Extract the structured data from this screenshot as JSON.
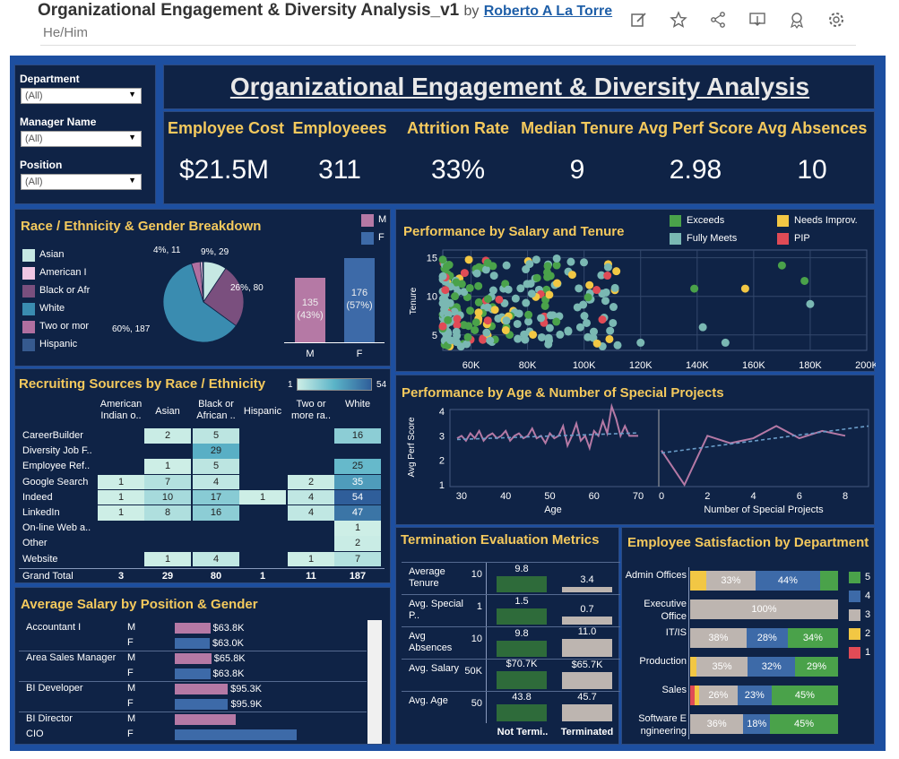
{
  "header": {
    "title": "Organizational Engagement & Diversity Analysis_v1",
    "by": "by",
    "author": "Roberto A La Torre",
    "pronouns": "He/Him"
  },
  "toolbar_icons": [
    "edit-icon",
    "star-icon",
    "share-icon",
    "download-icon",
    "badge-icon",
    "gear-icon"
  ],
  "filters": [
    {
      "label": "Department",
      "value": "(All)"
    },
    {
      "label": "Manager Name",
      "value": "(All)"
    },
    {
      "label": "Position",
      "value": "(All)"
    }
  ],
  "dashboard_title": "Organizational Engagement & Diversity Analysis",
  "kpis": [
    {
      "label": "Employee Cost",
      "value": "$21.5M"
    },
    {
      "label": "Employeees",
      "value": "311"
    },
    {
      "label": "Attrition Rate",
      "value": "33%"
    },
    {
      "label": "Median Tenure",
      "value": "9"
    },
    {
      "label": "Avg Perf Score",
      "value": "2.98"
    },
    {
      "label": "Avg Absences",
      "value": "10"
    }
  ],
  "race_section": {
    "title": "Race / Ethnicity & Gender Breakdown",
    "legend": [
      {
        "label": "Asian",
        "color": "#c6e8e3"
      },
      {
        "label": "American I",
        "color": "#f0c6e4"
      },
      {
        "label": "Black or Afr",
        "color": "#7a4f7e"
      },
      {
        "label": "White",
        "color": "#3a8cb0"
      },
      {
        "label": "Two or mor",
        "color": "#b06fa0"
      },
      {
        "label": "Hispanic",
        "color": "#365a8f"
      }
    ],
    "pie_labels": [
      "4%, 11",
      "9%, 29",
      "26%, 80",
      "60%, 187"
    ],
    "gender_legend": [
      {
        "label": "M",
        "color": "#b579a5"
      },
      {
        "label": "F",
        "color": "#3d6aa8"
      }
    ],
    "gender_bars": [
      {
        "label": "M",
        "text1": "135",
        "text2": "(43%)"
      },
      {
        "label": "F",
        "text1": "176",
        "text2": "(57%)"
      }
    ]
  },
  "recruiting": {
    "title": "Recruiting Sources by Race / Ethnicity",
    "scale_min": "1",
    "scale_max": "54",
    "columns": [
      "American Indian o..",
      "Asian",
      "Black or African ..",
      "Hispanic",
      "Two or more ra..",
      "White"
    ],
    "rows": [
      {
        "name": "CareerBuilder",
        "cells": [
          "",
          "2",
          "5",
          "",
          "",
          "16"
        ]
      },
      {
        "name": "Diversity Job F..",
        "cells": [
          "",
          "",
          "29",
          "",
          "",
          ""
        ]
      },
      {
        "name": "Employee Ref..",
        "cells": [
          "",
          "1",
          "5",
          "",
          "",
          "25"
        ]
      },
      {
        "name": "Google Search",
        "cells": [
          "1",
          "7",
          "4",
          "",
          "2",
          "35"
        ]
      },
      {
        "name": "Indeed",
        "cells": [
          "1",
          "10",
          "17",
          "1",
          "4",
          "54"
        ]
      },
      {
        "name": "LinkedIn",
        "cells": [
          "1",
          "8",
          "16",
          "",
          "4",
          "47"
        ]
      },
      {
        "name": "On-line Web a..",
        "cells": [
          "",
          "",
          "",
          "",
          "",
          "1"
        ]
      },
      {
        "name": "Other",
        "cells": [
          "",
          "",
          "",
          "",
          "",
          "2"
        ]
      },
      {
        "name": "Website",
        "cells": [
          "",
          "1",
          "4",
          "",
          "1",
          "7"
        ]
      }
    ],
    "total": {
      "name": "Grand Total",
      "cells": [
        "3",
        "29",
        "80",
        "1",
        "11",
        "187"
      ]
    }
  },
  "salary": {
    "title": "Average Salary by Position & Gender",
    "rows": [
      {
        "position": "Accountant I",
        "gender": "M",
        "label": "$63.8K",
        "value": 63.8
      },
      {
        "position": "",
        "gender": "F",
        "label": "$63.0K",
        "value": 63.0
      },
      {
        "position": "Area Sales Manager",
        "gender": "M",
        "label": "$65.8K",
        "value": 65.8
      },
      {
        "position": "",
        "gender": "F",
        "label": "$63.8K",
        "value": 63.8
      },
      {
        "position": "BI Developer",
        "gender": "M",
        "label": "$95.3K",
        "value": 95.3
      },
      {
        "position": "",
        "gender": "F",
        "label": "$95.9K",
        "value": 95.9
      },
      {
        "position": "BI Director",
        "gender": "M",
        "label": "",
        "value": 110
      },
      {
        "position": "CIO",
        "gender": "F",
        "label": "",
        "value": 220
      }
    ]
  },
  "perf_salary": {
    "title": "Performance by Salary and Tenure",
    "ylabel": "Tenure",
    "legend": [
      {
        "label": "Exceeds",
        "color": "#4aa24a"
      },
      {
        "label": "Needs Improv.",
        "color": "#f2c744"
      },
      {
        "label": "Fully Meets",
        "color": "#7ab8b3"
      },
      {
        "label": "PIP",
        "color": "#e04b56"
      }
    ],
    "xticks": [
      "60K",
      "80K",
      "100K",
      "120K",
      "140K",
      "160K",
      "180K",
      "200K"
    ],
    "yticks": [
      "5",
      "10",
      "15"
    ]
  },
  "perf_age": {
    "title": "Performance by Age & Number of Special Projects",
    "ylabel": "Avg Perf Score",
    "yticks": [
      "1",
      "2",
      "3",
      "4"
    ],
    "age_ticks": [
      "30",
      "40",
      "50",
      "60",
      "70"
    ],
    "proj_ticks": [
      "0",
      "2",
      "4",
      "6",
      "8"
    ],
    "xlabel_age": "Age",
    "xlabel_proj": "Number of Special Projects"
  },
  "termination": {
    "title": "Termination Evaluation Metrics",
    "metrics": [
      {
        "label": "Average Tenure",
        "tick": "10",
        "a": "9.8",
        "b": "3.4",
        "av": 9.8,
        "bv": 3.4,
        "max": 12
      },
      {
        "label": "Avg. Special P..",
        "tick": "1",
        "a": "1.5",
        "b": "0.7",
        "av": 1.5,
        "bv": 0.7,
        "max": 1.8
      },
      {
        "label": "Avg Absences",
        "tick": "10",
        "a": "9.8",
        "b": "11.0",
        "av": 9.8,
        "bv": 11.0,
        "max": 12
      },
      {
        "label": "Avg. Salary",
        "tick": "50K",
        "a": "$70.7K",
        "b": "$65.7K",
        "av": 70.7,
        "bv": 65.7,
        "max": 78
      },
      {
        "label": "Avg. Age",
        "tick": "50",
        "a": "43.8",
        "b": "45.7",
        "av": 43.8,
        "bv": 45.7,
        "max": 52
      }
    ],
    "col_a": "Not Termi..",
    "col_b": "Terminated"
  },
  "satisfaction": {
    "title": "Employee Satisfaction by Department",
    "legend": [
      {
        "label": "5",
        "color": "#4aa24a"
      },
      {
        "label": "4",
        "color": "#3d6aa8"
      },
      {
        "label": "3",
        "color": "#bdb5b0"
      },
      {
        "label": "2",
        "color": "#f2c744"
      },
      {
        "label": "1",
        "color": "#e04b56"
      }
    ],
    "rows": [
      {
        "dept": "Admin Offices",
        "segments": [
          {
            "v": 11,
            "c": "#f2c744",
            "t": ""
          },
          {
            "v": 33,
            "c": "#bdb5b0",
            "t": "33%"
          },
          {
            "v": 44,
            "c": "#3d6aa8",
            "t": "44%"
          },
          {
            "v": 12,
            "c": "#4aa24a",
            "t": ""
          }
        ]
      },
      {
        "dept": "Executive Office",
        "segments": [
          {
            "v": 100,
            "c": "#bdb5b0",
            "t": "100%"
          }
        ]
      },
      {
        "dept": "IT/IS",
        "segments": [
          {
            "v": 38,
            "c": "#bdb5b0",
            "t": "38%"
          },
          {
            "v": 28,
            "c": "#3d6aa8",
            "t": "28%"
          },
          {
            "v": 34,
            "c": "#4aa24a",
            "t": "34%"
          }
        ]
      },
      {
        "dept": "Production",
        "segments": [
          {
            "v": 4,
            "c": "#f2c744",
            "t": ""
          },
          {
            "v": 35,
            "c": "#bdb5b0",
            "t": "35%"
          },
          {
            "v": 32,
            "c": "#3d6aa8",
            "t": "32%"
          },
          {
            "v": 29,
            "c": "#4aa24a",
            "t": "29%"
          }
        ]
      },
      {
        "dept": "Sales",
        "segments": [
          {
            "v": 3,
            "c": "#e04b56",
            "t": ""
          },
          {
            "v": 3,
            "c": "#f2c744",
            "t": ""
          },
          {
            "v": 26,
            "c": "#bdb5b0",
            "t": "26%"
          },
          {
            "v": 23,
            "c": "#3d6aa8",
            "t": "23%"
          },
          {
            "v": 45,
            "c": "#4aa24a",
            "t": "45%"
          }
        ]
      },
      {
        "dept": "Software E ngineering",
        "segments": [
          {
            "v": 36,
            "c": "#bdb5b0",
            "t": "36%"
          },
          {
            "v": 18,
            "c": "#3d6aa8",
            "t": "18%"
          },
          {
            "v": 46,
            "c": "#4aa24a",
            "t": "45%"
          }
        ]
      }
    ]
  },
  "chart_data": [
    {
      "type": "pie",
      "title": "Race / Ethnicity & Gender Breakdown",
      "categories": [
        "White",
        "Black or African American",
        "Asian",
        "Two or more races",
        "American Indian",
        "Hispanic"
      ],
      "values": [
        187,
        80,
        29,
        11,
        3,
        1
      ]
    },
    {
      "type": "bar",
      "categories": [
        "M",
        "F"
      ],
      "values": [
        135,
        176
      ]
    },
    {
      "type": "heatmap",
      "title": "Recruiting Sources by Race / Ethnicity",
      "x": [
        "American Indian o..",
        "Asian",
        "Black or African ..",
        "Hispanic",
        "Two or more ra..",
        "White"
      ],
      "y": [
        "CareerBuilder",
        "Diversity Job F..",
        "Employee Ref..",
        "Google Search",
        "Indeed",
        "LinkedIn",
        "On-line Web a..",
        "Other",
        "Website"
      ],
      "values": [
        [
          null,
          2,
          5,
          null,
          null,
          16
        ],
        [
          null,
          null,
          29,
          null,
          null,
          null
        ],
        [
          null,
          1,
          5,
          null,
          null,
          25
        ],
        [
          1,
          7,
          4,
          null,
          2,
          35
        ],
        [
          1,
          10,
          17,
          1,
          4,
          54
        ],
        [
          1,
          8,
          16,
          null,
          4,
          47
        ],
        [
          null,
          null,
          null,
          null,
          null,
          1
        ],
        [
          null,
          null,
          null,
          null,
          null,
          2
        ],
        [
          null,
          1,
          4,
          null,
          1,
          7
        ]
      ]
    },
    {
      "type": "scatter",
      "title": "Performance by Salary and Tenure",
      "ylabel": "Tenure",
      "xlim": [
        50000,
        200000
      ],
      "ylim": [
        3,
        16
      ]
    },
    {
      "type": "line",
      "title": "Performance by Age & Number of Special Projects",
      "ylabel": "Avg Perf Score",
      "ylim": [
        1,
        4
      ],
      "series": [
        {
          "x": [
            29,
            30,
            31,
            32,
            33,
            34,
            35,
            36,
            37,
            38,
            39,
            40,
            41,
            42,
            43,
            44,
            45,
            46,
            47,
            48,
            49,
            50,
            51,
            52,
            53,
            54,
            55,
            56,
            57,
            58,
            59,
            60,
            61,
            62,
            63,
            64,
            65,
            66,
            67,
            68,
            70
          ],
          "values": [
            2.9,
            3.0,
            2.8,
            3.1,
            2.9,
            3.2,
            2.8,
            3.0,
            3.1,
            2.9,
            3.0,
            3.2,
            2.8,
            3.0,
            3.1,
            2.9,
            3.0,
            3.3,
            2.9,
            3.0,
            2.7,
            3.1,
            2.9,
            3.0,
            3.4,
            2.6,
            3.0,
            3.5,
            2.8,
            3.0,
            2.5,
            3.2,
            3.0,
            3.6,
            3.1,
            4.2,
            3.7,
            3.0,
            3.4,
            3.0,
            3.0
          ]
        },
        {
          "x": [
            0,
            1,
            2,
            3,
            4,
            5,
            6,
            7,
            8
          ],
          "values": [
            2.4,
            1.0,
            3.0,
            2.7,
            2.9,
            3.4,
            2.9,
            3.2,
            3.0
          ]
        }
      ]
    },
    {
      "type": "bar",
      "title": "Termination Evaluation Metrics",
      "categories": [
        "Average Tenure",
        "Avg. Special P..",
        "Avg Absences",
        "Avg. Salary",
        "Avg. Age"
      ],
      "series": [
        {
          "name": "Not Termi..",
          "values": [
            9.8,
            1.5,
            9.8,
            70.7,
            43.8
          ]
        },
        {
          "name": "Terminated",
          "values": [
            3.4,
            0.7,
            11.0,
            65.7,
            45.7
          ]
        }
      ]
    },
    {
      "type": "bar",
      "title": "Employee Satisfaction by Department",
      "categories": [
        "Admin Offices",
        "Executive Office",
        "IT/IS",
        "Production",
        "Sales",
        "Software E ngineering"
      ],
      "series": [
        {
          "name": "5",
          "values": [
            null,
            0,
            34,
            29,
            45,
            45
          ]
        },
        {
          "name": "4",
          "values": [
            44,
            0,
            28,
            32,
            23,
            18
          ]
        },
        {
          "name": "3",
          "values": [
            33,
            100,
            38,
            35,
            26,
            36
          ]
        }
      ]
    }
  ]
}
